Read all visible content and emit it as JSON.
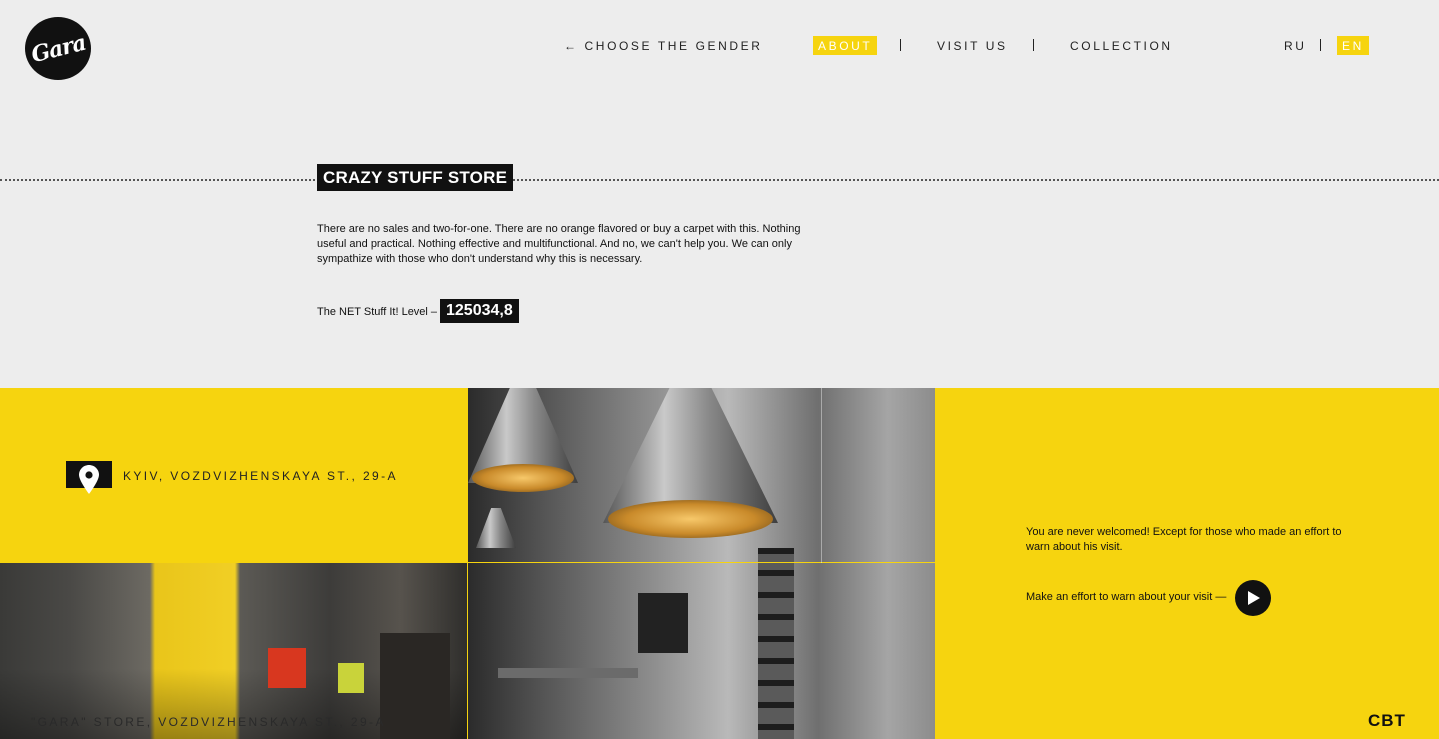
{
  "header": {
    "logo_text": "Gara",
    "nav": {
      "back": "← CHOOSE THE GENDER",
      "about": "ABOUT",
      "visit": "VISIT US",
      "collection": "COLLECTION"
    },
    "lang": {
      "ru": "RU",
      "en": "EN",
      "active": "EN"
    }
  },
  "hero": {
    "title": "CRAZY STUFF STORE",
    "intro": "There are no sales and two-for-one. There are no orange flavored or buy a carpet with this. Nothing useful and practical. Nothing effective and multifunctional. And no, we can't help you. We can only sympathize with those who don't understand why this is necessary.",
    "level_label": "The NET Stuff It! Level –",
    "level_value": "125034,8"
  },
  "location": {
    "address": "KYIV, VOZDVIZHENSKAYA ST., 29-A",
    "icon": "map-pin-icon"
  },
  "photos": {
    "store_caption": "\"GARA\" STORE, VOZDVIZHENSKAYA ST., 29-A"
  },
  "visit": {
    "welcome": "You are never welcomed! Except for those who made an effort to warn about his visit.",
    "warn_label": "Make an effort to warn about your visit —",
    "play_icon": "play-icon",
    "footer_mark": "CBT"
  },
  "colors": {
    "accent": "#f6d40f",
    "dark": "#111111",
    "background": "#ededed"
  }
}
